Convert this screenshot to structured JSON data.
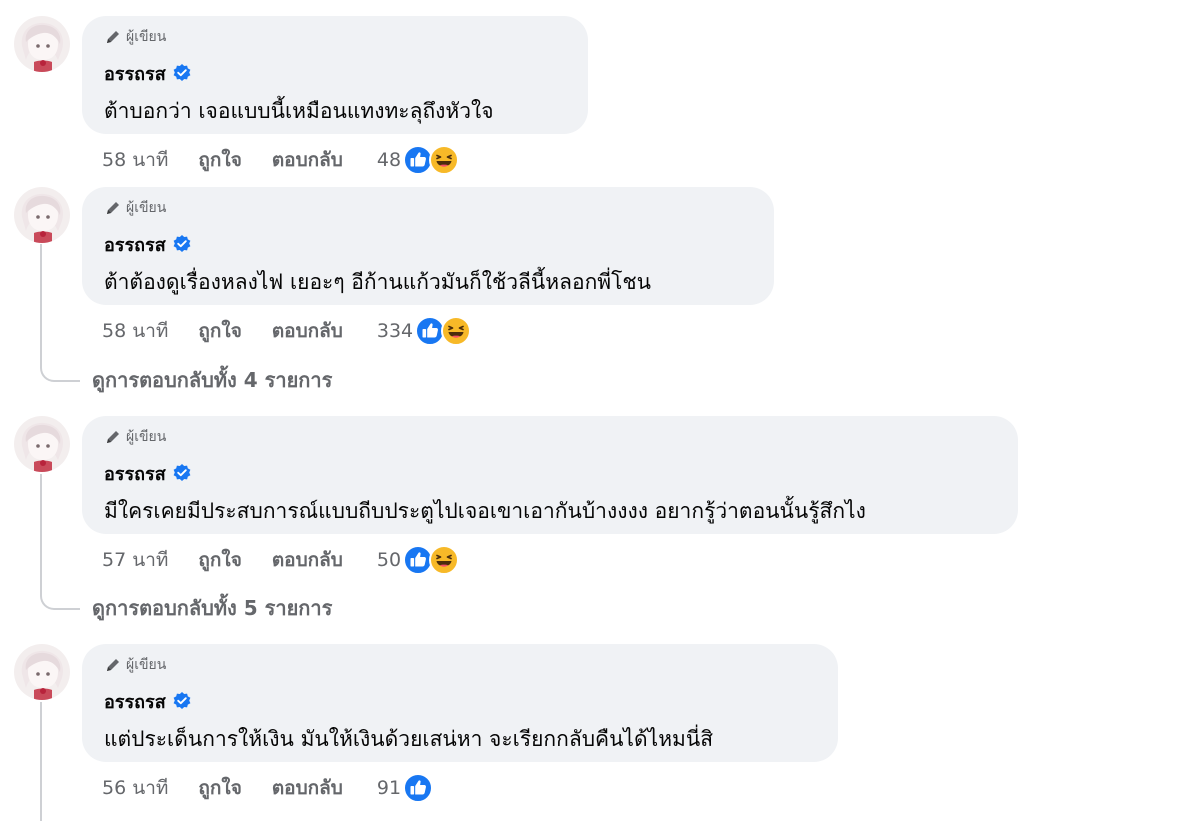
{
  "comments": [
    {
      "author_badge": "ผู้เขียน",
      "author": "อรรถรส",
      "text": "ต้าบอกว่า เจอแบบนี้เหมือนแทงทะลุถึงหัวใจ",
      "time": "58 นาที",
      "like_label": "ถูกใจ",
      "reply_label": "ตอบกลับ",
      "reaction_count": "48",
      "reactions": [
        "like-icon",
        "haha-icon"
      ]
    },
    {
      "author_badge": "ผู้เขียน",
      "author": "อรรถรส",
      "text": "ต้าต้องดูเรื่องหลงไฟ เยอะๆ อีก้านแก้วมันก็ใช้วลีนี้หลอกพี่โชน",
      "time": "58 นาที",
      "like_label": "ถูกใจ",
      "reply_label": "ตอบกลับ",
      "reaction_count": "334",
      "reactions": [
        "like-icon",
        "haha-icon"
      ],
      "view_replies": "ดูการตอบกลับทั้ง 4 รายการ"
    },
    {
      "author_badge": "ผู้เขียน",
      "author": "อรรถรส",
      "text": "มีใครเคยมีประสบการณ์แบบถีบประตูไปเจอเขาเอากันบ้างงงง อยากรู้ว่าตอนนั้นรู้สึกไง",
      "time": "57 นาที",
      "like_label": "ถูกใจ",
      "reply_label": "ตอบกลับ",
      "reaction_count": "50",
      "reactions": [
        "like-icon",
        "haha-icon"
      ],
      "view_replies": "ดูการตอบกลับทั้ง 5 รายการ"
    },
    {
      "author_badge": "ผู้เขียน",
      "author": "อรรถรส",
      "text": "แต่ประเด็นการให้เงิน มันให้เงินด้วยเสน่หา จะเรียกกลับคืนได้ไหมนี่สิ",
      "time": "56 นาที",
      "like_label": "ถูกใจ",
      "reply_label": "ตอบกลับ",
      "reaction_count": "91",
      "reactions": [
        "like-icon"
      ]
    }
  ],
  "colors": {
    "bubble": "#f0f2f5",
    "meta_text": "#65676b",
    "verified": "#1877f2",
    "like": "#1877f2",
    "haha": "#f7b928"
  }
}
